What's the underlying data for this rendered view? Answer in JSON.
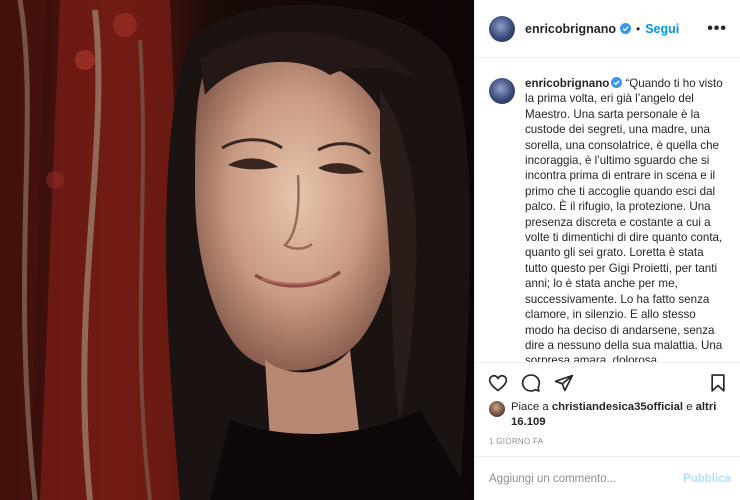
{
  "header": {
    "username": "enricobrignano",
    "separator": "•",
    "follow_label": "Segui",
    "more_label": "•••",
    "verified_icon": "verified-badge-icon"
  },
  "caption": {
    "username": "enricobrignano",
    "text": "“Quando ti ho visto la prima volta, eri già l’angelo del Maestro. Una sarta personale è la custode dei segreti, una madre, una sorella, una consolatrice, è quella che incoraggia, è l’ultimo sguardo che si incontra prima di entrare in scena e il primo che ti accoglie quando esci dal palco. È il rifugio, la protezione. Una presenza discreta e costante a cui a volte ti dimentichi di dire quanto conta, quanto gli sei grato. Loretta è stata tutto questo per Gigi Proietti, per tanti anni; lo è stata anche per me, successivamente. Lo ha fatto senza clamore, in silenzio. E allo stesso modo ha deciso di andarsene, senza dire a nessuno della sua malattia. Una sorpresa amara, dolorosa"
  },
  "actions": {
    "icons": [
      "heart-icon",
      "comment-icon",
      "share-icon",
      "bookmark-icon"
    ]
  },
  "likes": {
    "prefix": "Piace a",
    "liker": "christiandesica35official",
    "connector": "e",
    "others": "altri 16.109"
  },
  "timestamp": "1 GIORNO FA",
  "comment_box": {
    "placeholder": "Aggiungi un commento...",
    "publish_label": "Pubblica"
  },
  "colors": {
    "accent": "#0095f6",
    "publish_disabled": "#b2dffc",
    "muted": "#8e8e8e",
    "border": "#efefef"
  }
}
